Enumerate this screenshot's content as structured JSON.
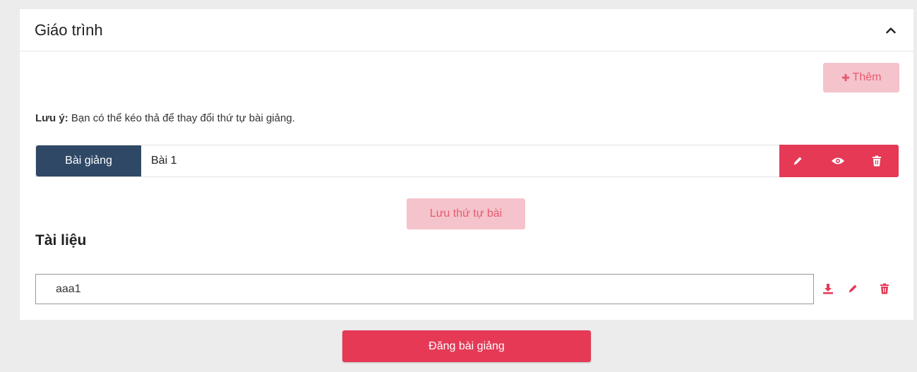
{
  "syllabus": {
    "title": "Giáo trình",
    "add_label": "Thêm",
    "note_bold": "Lưu ý:",
    "note_text": " Bạn có thể kéo thả để thay đổi thứ tự bài giảng.",
    "lessons": [
      {
        "type": "Bài giảng",
        "title": "Bài 1"
      }
    ],
    "save_order_label": "Lưu thứ tự bài"
  },
  "documents": {
    "heading": "Tài liệu",
    "items": [
      {
        "value": "aaa1"
      }
    ]
  },
  "submit_label": "Đăng bài giảng",
  "colors": {
    "primary": "#e53956",
    "primary_light": "#f5c3cb",
    "lesson_type_bg": "#2f4866",
    "page_bg": "#ececec"
  },
  "icons": [
    "chevron-up-icon",
    "plus-icon",
    "pencil-icon",
    "eye-icon",
    "trash-icon",
    "download-icon"
  ]
}
